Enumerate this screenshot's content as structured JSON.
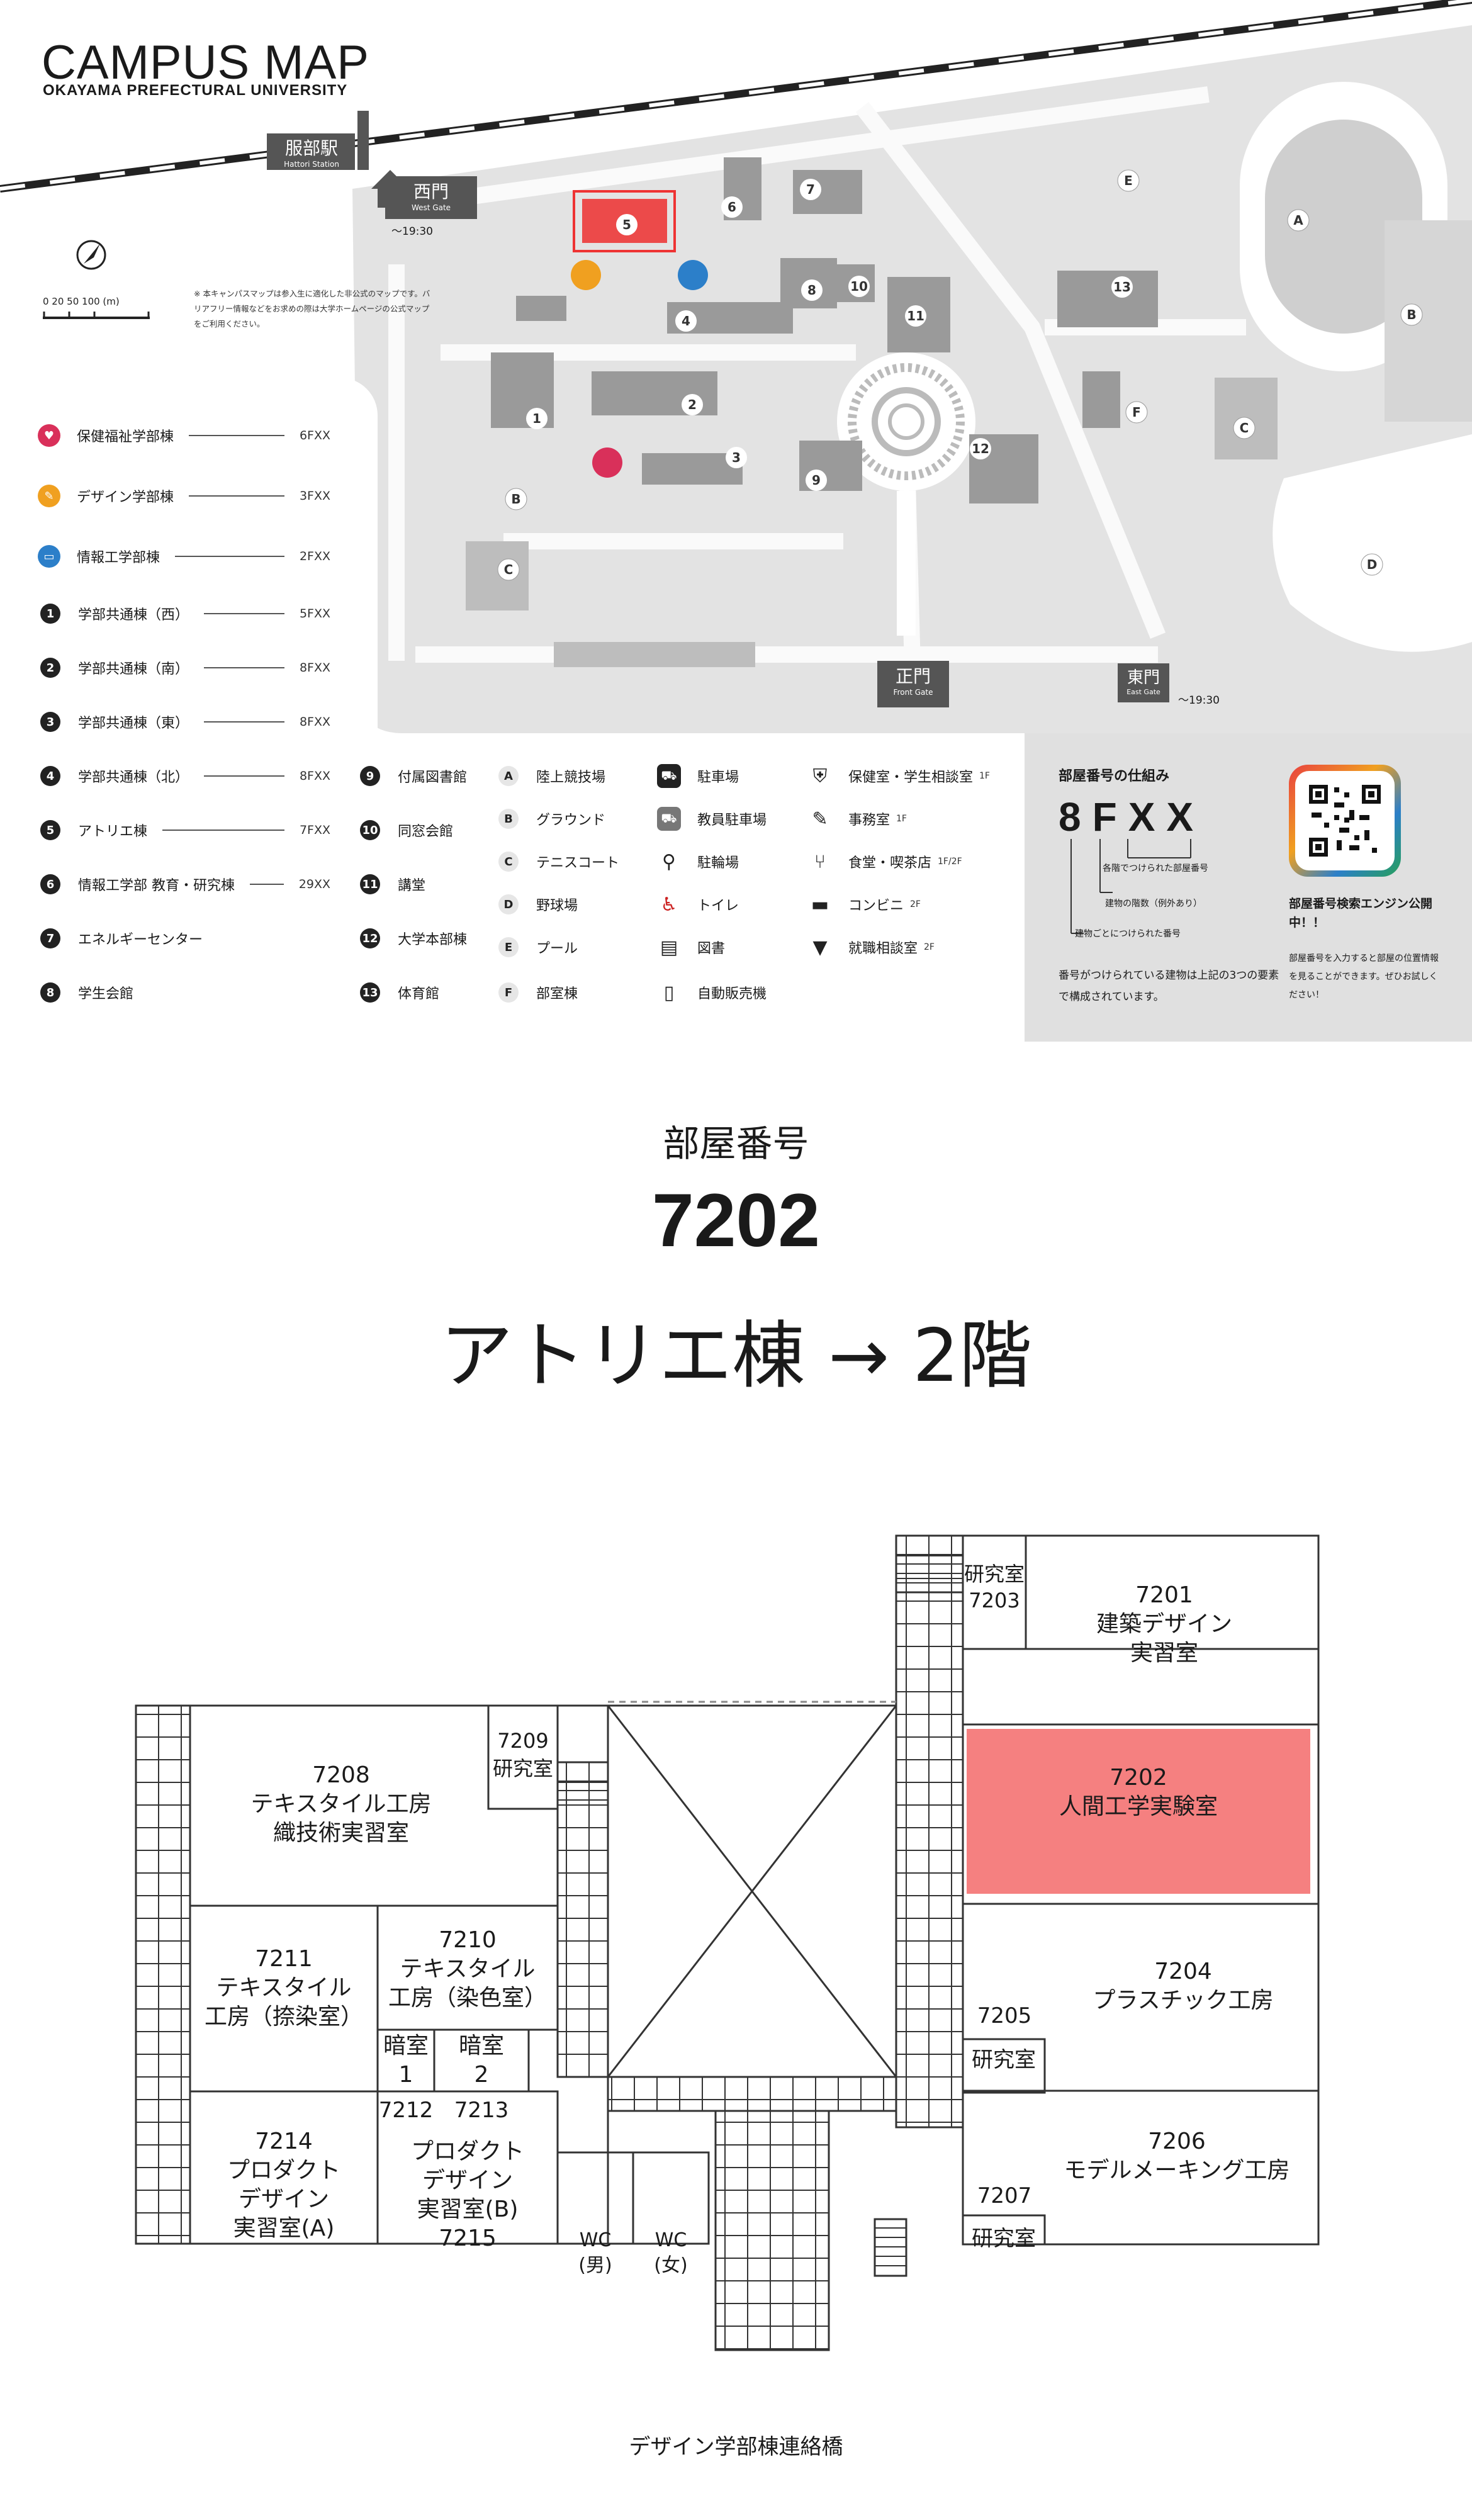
{
  "header": {
    "title": "CAMPUS MAP",
    "subtitle": "OKAYAMA PREFECTURAL UNIVERSITY",
    "note": "※ 本キャンパスマップは参入生に適化した非公式のマップです。バリアフリー情報などをお求めの際は大学ホームページの公式マップをご利用ください。",
    "scale": "0  20  50     100 (m)"
  },
  "map": {
    "station": {
      "ja": "服部駅",
      "en": "Hattori Station"
    },
    "west_gate": {
      "ja": "西門",
      "en": "West Gate",
      "hours": "〜19:30"
    },
    "front_gate": {
      "ja": "正門",
      "en": "Front Gate"
    },
    "east_gate": {
      "ja": "東門",
      "en": "East Gate",
      "hours": "〜19:30"
    },
    "buildings": [
      "1",
      "2",
      "3",
      "4",
      "5",
      "6",
      "7",
      "8",
      "9",
      "10",
      "11",
      "12",
      "13"
    ],
    "facilities": [
      "A",
      "B",
      "C",
      "D",
      "E",
      "F",
      "B",
      "C"
    ],
    "highlight_color": "#ec4a4a"
  },
  "legend": {
    "faculties": [
      {
        "label": "保健福祉学部棟",
        "floor": "6FXX",
        "color": "#d9305a",
        "icon": "heart-hand-icon"
      },
      {
        "label": "デザイン学部棟",
        "floor": "3FXX",
        "color": "#f0a020",
        "icon": "design-icon"
      },
      {
        "label": "情報工学部棟",
        "floor": "2FXX",
        "color": "#2c7fc9",
        "icon": "computer-icon"
      }
    ],
    "buildings_col1": [
      {
        "num": "1",
        "label": "学部共通棟（西）",
        "floor": "5FXX"
      },
      {
        "num": "2",
        "label": "学部共通棟（南）",
        "floor": "8FXX"
      },
      {
        "num": "3",
        "label": "学部共通棟（東）",
        "floor": "8FXX"
      },
      {
        "num": "4",
        "label": "学部共通棟（北）",
        "floor": "8FXX"
      },
      {
        "num": "5",
        "label": "アトリエ棟",
        "floor": "7FXX"
      },
      {
        "num": "6",
        "label": "情報工学部 教育・研究棟",
        "floor": "29XX"
      },
      {
        "num": "7",
        "label": "エネルギーセンター",
        "floor": ""
      },
      {
        "num": "8",
        "label": "学生会館",
        "floor": ""
      }
    ],
    "buildings_col2": [
      {
        "num": "9",
        "label": "付属図書館"
      },
      {
        "num": "10",
        "label": "同窓会館"
      },
      {
        "num": "11",
        "label": "講堂"
      },
      {
        "num": "12",
        "label": "大学本部棟"
      },
      {
        "num": "13",
        "label": "体育館"
      }
    ],
    "facilities": [
      {
        "letter": "A",
        "label": "陸上競技場"
      },
      {
        "letter": "B",
        "label": "グラウンド"
      },
      {
        "letter": "C",
        "label": "テニスコート"
      },
      {
        "letter": "D",
        "label": "野球場"
      },
      {
        "letter": "E",
        "label": "プール"
      },
      {
        "letter": "F",
        "label": "部室棟"
      }
    ],
    "amenities1": [
      {
        "icon": "car-icon",
        "label": "駐車場"
      },
      {
        "icon": "staff-car-icon",
        "label": "教員駐車場"
      },
      {
        "icon": "bicycle-icon",
        "label": "駐輪場"
      },
      {
        "icon": "toilet-icon",
        "label": "トイレ"
      },
      {
        "icon": "books-icon",
        "label": "図書"
      },
      {
        "icon": "vending-icon",
        "label": "自動販売機"
      }
    ],
    "amenities2": [
      {
        "icon": "shield-heart-icon",
        "label": "保健室・学生相談室",
        "floor": "1F"
      },
      {
        "icon": "pen-icon",
        "label": "事務室",
        "floor": "1F"
      },
      {
        "icon": "fork-knife-icon",
        "label": "食堂・喫茶店",
        "floor": "1F/2F"
      },
      {
        "icon": "store-icon",
        "label": "コンビニ",
        "floor": "2F"
      },
      {
        "icon": "tie-icon",
        "label": "就職相談室",
        "floor": "2F"
      }
    ]
  },
  "info_box": {
    "heading": "部屋番号の仕組み",
    "code": "8FXX",
    "explain1": "各階でつけられた部屋番号",
    "explain2": "建物の階数（例外あり）",
    "explain3": "建物ごとにつけられた番号",
    "body": "番号がつけられている建物は上記の3つの要素で構成されています。",
    "engine_title": "部屋番号検索エンジン公開中！！",
    "engine_body": "部屋番号を入力すると部屋の位置情報を見ることができます。ぜひお試しください！"
  },
  "room_info": {
    "label": "部屋番号",
    "number": "7202",
    "building_floor": "アトリエ棟 → 2階"
  },
  "floorplan": {
    "rooms": {
      "r7201": [
        "7201",
        "建築デザイン",
        "実習室"
      ],
      "r7202": [
        "7202",
        "人間工学実験室"
      ],
      "r7203": [
        "研究室",
        "7203"
      ],
      "r7204": [
        "7204",
        "プラスチック工房"
      ],
      "r7205": [
        "7205"
      ],
      "r7205lab": [
        "研究室"
      ],
      "r7206": [
        "7206",
        "モデルメーキング工房"
      ],
      "r7207": [
        "7207"
      ],
      "r7207lab": [
        "研究室"
      ],
      "r7208": [
        "7208",
        "テキスタイル工房",
        "織技術実習室"
      ],
      "r7209": [
        "7209",
        "研究室"
      ],
      "r7210": [
        "7210",
        "テキスタイル",
        "工房（染色室）"
      ],
      "r7211": [
        "7211",
        "テキスタイル",
        "工房（捺染室）"
      ],
      "dark1": [
        "暗室",
        "1"
      ],
      "dark2": [
        "暗室",
        "2"
      ],
      "n7212": [
        "7212"
      ],
      "n7213": [
        "7213"
      ],
      "r7214": [
        "7214",
        "プロダクト",
        "デザイン",
        "実習室(A)"
      ],
      "r7215": [
        "プロダクト",
        "デザイン",
        "実習室(B)",
        "7215"
      ],
      "wcm": [
        "WC",
        "(男)"
      ],
      "wcf": [
        "WC",
        "(女)"
      ]
    },
    "bridge": "デザイン学部棟連絡橋",
    "highlight_color": "#f58080"
  }
}
